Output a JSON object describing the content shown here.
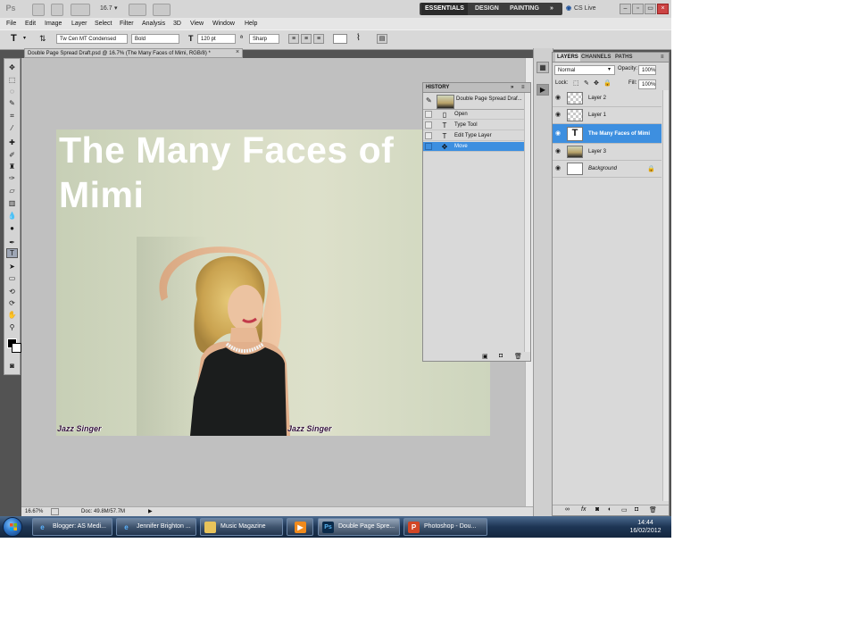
{
  "app": {
    "logo": "Ps",
    "zoom_display": "16.7",
    "workspaces": [
      "ESSENTIALS",
      "DESIGN",
      "PAINTING"
    ],
    "more": "»",
    "cs_live": "CS Live"
  },
  "menu": [
    "File",
    "Edit",
    "Image",
    "Layer",
    "Select",
    "Filter",
    "Analysis",
    "3D",
    "View",
    "Window",
    "Help"
  ],
  "options": {
    "tool_glyph": "T",
    "font_family": "Tw Cen MT Condensed",
    "font_style": "Bold",
    "font_size": "120 pt",
    "antialias": "Sharp"
  },
  "document": {
    "tab_title": "Double Page Spread Draft.psd @ 16.7% (The Many Faces of Mimi, RGB/8) *",
    "close": "×",
    "title_line1": "The Many Faces of",
    "title_line2": "Mimi",
    "label_left": "Jazz Singer",
    "label_right": "Jazz Singer"
  },
  "status": {
    "zoom": "16.67%",
    "doc": "Doc: 49.8M/57.7M"
  },
  "history": {
    "tab": "HISTORY",
    "snapshot": "Double Page Spread Draf...",
    "items": [
      {
        "label": "Open"
      },
      {
        "label": "Type Tool"
      },
      {
        "label": "Edit Type Layer"
      },
      {
        "label": "Move"
      }
    ]
  },
  "layers_panel": {
    "tabs": [
      "LAYERS",
      "CHANNELS",
      "PATHS"
    ],
    "blend_mode": "Normal",
    "opacity_label": "Opacity:",
    "opacity": "100%",
    "lock_label": "Lock:",
    "fill_label": "Fill:",
    "fill": "100%",
    "layers": [
      {
        "name": "Layer 2"
      },
      {
        "name": "Layer 1"
      },
      {
        "name": "The Many Faces of Mimi"
      },
      {
        "name": "Layer 3"
      },
      {
        "name": "Background"
      }
    ]
  },
  "taskbar": {
    "items": [
      {
        "label": "Blogger: AS Medi..."
      },
      {
        "label": "Jennifer Brighton ..."
      },
      {
        "label": "Music Magazine"
      },
      {
        "label": ""
      },
      {
        "label": "Double Page Spre..."
      },
      {
        "label": "Photoshop - Dou..."
      }
    ],
    "time": "14:44",
    "date": "16/02/2012"
  },
  "colors": {
    "selection": "#3d8fe0",
    "workspace_bg": "#535353",
    "canvas_bg": "#c0c0c0"
  }
}
